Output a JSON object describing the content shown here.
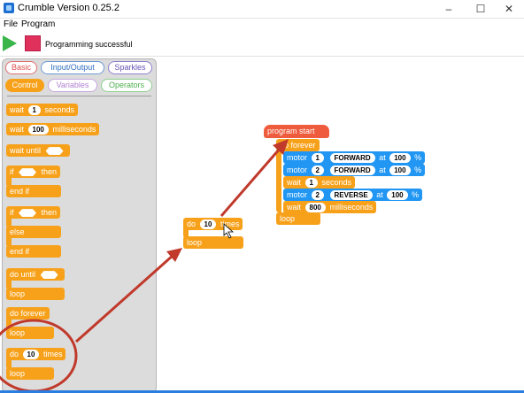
{
  "window": {
    "title": "Crumble Version 0.25.2",
    "minimize": "–",
    "maximize": "☐",
    "close": "✕"
  },
  "menu": {
    "file": "File",
    "program": "Program"
  },
  "toolbar": {
    "status": "Programming successful"
  },
  "palette": {
    "categories": [
      "Basic",
      "Input/Output",
      "Sparkles",
      "Control",
      "Variables",
      "Operators"
    ],
    "active_category": "Control",
    "blocks": {
      "wait_label": "wait",
      "wait_value": "1",
      "wait_unit": "seconds",
      "waitms_label": "wait",
      "waitms_value": "100",
      "waitms_unit": "milliseconds",
      "wait_until": "wait until",
      "if1_label": "if",
      "if1_then": "then",
      "if1_end": "end if",
      "if2_label": "if",
      "if2_then": "then",
      "if2_else": "else",
      "if2_end": "end if",
      "do_until": "do until",
      "do_until_loop": "loop",
      "do_forever": "do forever",
      "do_forever_loop": "loop",
      "do_times_label": "do",
      "do_times_value": "10",
      "do_times_unit": "times",
      "do_times_loop": "loop"
    }
  },
  "canvas": {
    "dragged": {
      "label": "do",
      "value": "10",
      "unit": "times",
      "loop": "loop"
    },
    "program": {
      "start": "program start",
      "forever": "do forever",
      "loop": "loop",
      "statements": [
        {
          "kind": "motor",
          "label": "motor",
          "num": "1",
          "dir": "FORWARD",
          "at": "at",
          "speed": "100",
          "pct": "%"
        },
        {
          "kind": "motor",
          "label": "motor",
          "num": "2",
          "dir": "FORWARD",
          "at": "at",
          "speed": "100",
          "pct": "%"
        },
        {
          "kind": "wait",
          "label": "wait",
          "value": "1",
          "unit": "seconds"
        },
        {
          "kind": "motor",
          "label": "motor",
          "num": "2",
          "dir": "REVERSE",
          "at": "at",
          "speed": "100",
          "pct": "%"
        },
        {
          "kind": "wait",
          "label": "wait",
          "value": "800",
          "unit": "milliseconds"
        }
      ]
    }
  },
  "colors": {
    "control": "#f7a11b",
    "motor": "#2196f3",
    "start": "#ef5b3d",
    "annotation": "#c0392b"
  }
}
